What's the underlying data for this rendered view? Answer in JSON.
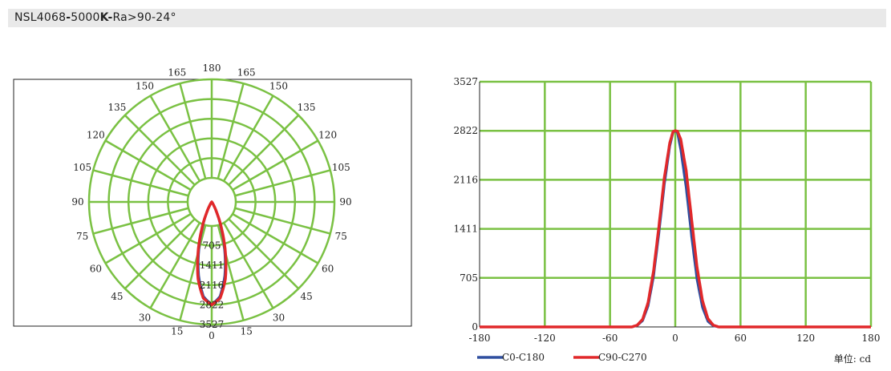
{
  "header": {
    "model": "NSL4068",
    "sep1": "-",
    "cct_value": "5000",
    "cct_unit": "K",
    "sep2": "-",
    "rest": "Ra>90-24°"
  },
  "colors": {
    "grid": "#7ac143",
    "c0_c180": "#2f4f9f",
    "c90_c270": "#e1282a"
  },
  "chart_data": [
    {
      "type": "polar",
      "angle_labels": [
        "0",
        "15",
        "30",
        "45",
        "60",
        "75",
        "90",
        "105",
        "120",
        "135",
        "150",
        "165",
        "180"
      ],
      "radial_labels": [
        "705",
        "1411",
        "2116",
        "2822",
        "3527"
      ],
      "rmax": 3527,
      "peak_intensity": 2822,
      "series": [
        {
          "name": "C0-C180",
          "half_angle_deg": 12,
          "points": [
            [
              0,
              2822
            ],
            [
              5,
              2600
            ],
            [
              10,
              2050
            ],
            [
              15,
              1350
            ],
            [
              20,
              720
            ],
            [
              25,
              300
            ],
            [
              30,
              90
            ],
            [
              35,
              20
            ],
            [
              40,
              0
            ]
          ]
        },
        {
          "name": "C90-C270",
          "half_angle_deg": 13,
          "points": [
            [
              0,
              2822
            ],
            [
              5,
              2650
            ],
            [
              10,
              2150
            ],
            [
              15,
              1450
            ],
            [
              20,
              800
            ],
            [
              25,
              350
            ],
            [
              30,
              110
            ],
            [
              35,
              25
            ],
            [
              40,
              0
            ]
          ]
        }
      ]
    },
    {
      "type": "line",
      "x_ticks": [
        "-180",
        "-120",
        "-60",
        "0",
        "60",
        "120",
        "180"
      ],
      "y_ticks": [
        "0",
        "705",
        "1411",
        "2116",
        "2822",
        "3527"
      ],
      "xlim": [
        -180,
        180
      ],
      "ylim": [
        0,
        3527
      ],
      "grid": true,
      "legend_position": "bottom-left",
      "unit_label": "单位: cd",
      "series": [
        {
          "name": "C0-C180",
          "x": [
            -180,
            -40,
            -35,
            -30,
            -25,
            -20,
            -15,
            -10,
            -5,
            -2,
            0,
            2,
            5,
            10,
            15,
            20,
            25,
            30,
            35,
            40,
            180
          ],
          "y": [
            0,
            0,
            20,
            90,
            300,
            720,
            1350,
            2050,
            2600,
            2800,
            2822,
            2790,
            2550,
            2000,
            1300,
            680,
            280,
            80,
            15,
            0,
            0
          ]
        },
        {
          "name": "C90-C270",
          "x": [
            -180,
            -40,
            -35,
            -30,
            -25,
            -20,
            -15,
            -10,
            -5,
            -2,
            0,
            2,
            5,
            10,
            15,
            20,
            25,
            30,
            35,
            40,
            180
          ],
          "y": [
            0,
            0,
            25,
            110,
            350,
            800,
            1450,
            2150,
            2650,
            2810,
            2822,
            2815,
            2700,
            2250,
            1550,
            860,
            380,
            120,
            25,
            0,
            0
          ]
        }
      ]
    }
  ]
}
